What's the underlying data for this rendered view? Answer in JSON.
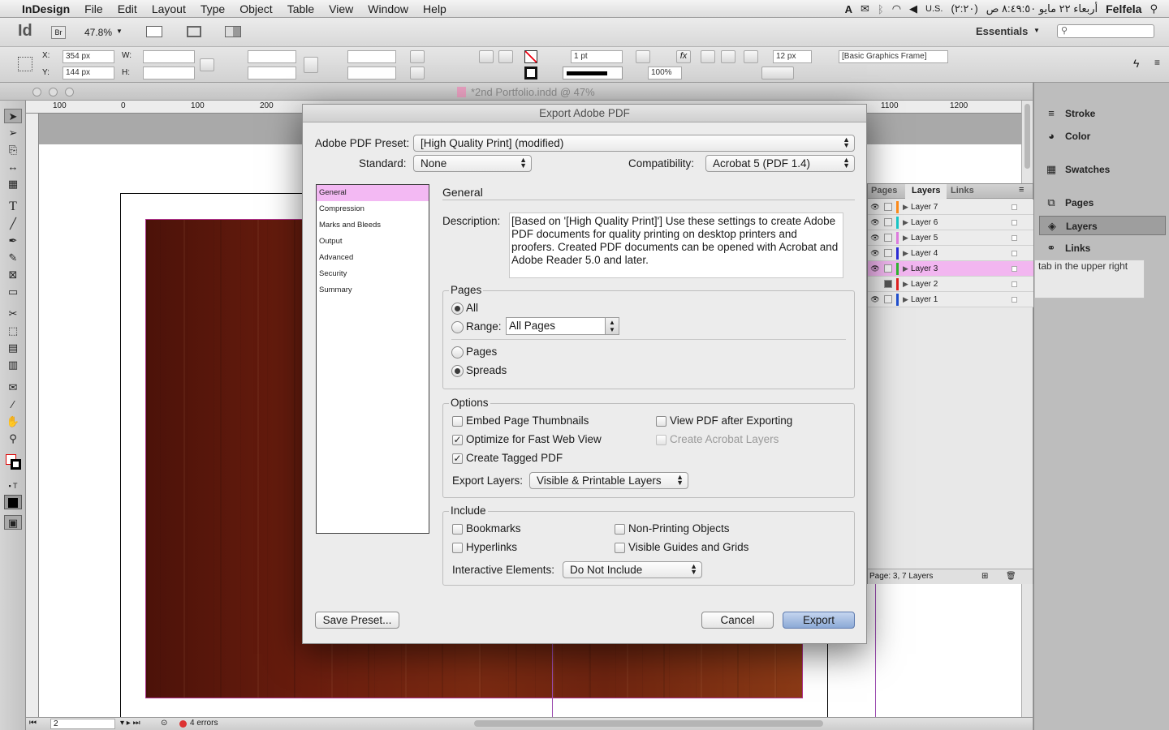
{
  "menubar": {
    "apple": "",
    "app": "InDesign",
    "items": [
      "File",
      "Edit",
      "Layout",
      "Type",
      "Object",
      "Table",
      "View",
      "Window",
      "Help"
    ],
    "status": {
      "input": "U.S.",
      "battery": "(٢:٢٠)",
      "clock": "أربعاء ٢٢ مايو  ٨:٤٩:٥٠ ص",
      "user": "Felfela"
    }
  },
  "appbar": {
    "logo": "Id",
    "bridge": "Br",
    "zoom": "47.8%",
    "workspace": "Essentials"
  },
  "control": {
    "x_label": "X:",
    "x": "354 px",
    "y_label": "Y:",
    "y": "144 px",
    "w_label": "W:",
    "h_label": "H:",
    "stroke_weight": "1 pt",
    "scale": "100%",
    "offset": "12 px",
    "style": "[Basic Graphics Frame]"
  },
  "document": {
    "tab_title": "*2nd Portfolio.indd @ 47%"
  },
  "ruler": {
    "h_ticks": [
      "100",
      "0",
      "100",
      "200",
      "1100",
      "1200"
    ]
  },
  "statusbar": {
    "page": "2",
    "errors": "4 errors"
  },
  "dock": {
    "items": [
      "Stroke",
      "Color",
      "Swatches",
      "Pages",
      "Layers",
      "Links"
    ]
  },
  "layers_panel": {
    "tabs": [
      "Pages",
      "Layers",
      "Links"
    ],
    "layers": [
      "Layer 7",
      "Layer 6",
      "Layer 5",
      "Layer 4",
      "Layer 3",
      "Layer 2",
      "Layer 1"
    ],
    "selected": "Layer 3",
    "footer": "Page: 3, 7 Layers",
    "swatch_colors": [
      "#ff8c1a",
      "#18c8c8",
      "#e17de1",
      "#2b2bd8",
      "#2fb52f",
      "#e02020",
      "#2050d0"
    ]
  },
  "hint_text": "tab in the upper right",
  "dialog": {
    "title": "Export Adobe PDF",
    "preset_label": "Adobe PDF Preset:",
    "preset": "[High Quality Print] (modified)",
    "standard_label": "Standard:",
    "standard": "None",
    "compat_label": "Compatibility:",
    "compat": "Acrobat 5 (PDF 1.4)",
    "categories": [
      "General",
      "Compression",
      "Marks and Bleeds",
      "Output",
      "Advanced",
      "Security",
      "Summary"
    ],
    "section": "General",
    "desc_label": "Description:",
    "description": "[Based on '[High Quality Print]'] Use these settings to create Adobe PDF documents for quality printing on desktop printers and proofers.  Created PDF documents can be opened with Acrobat and Adobe Reader 5.0 and later.",
    "pages": {
      "title": "Pages",
      "all": "All",
      "range": "Range:",
      "range_value": "All Pages",
      "pages": "Pages",
      "spreads": "Spreads"
    },
    "options": {
      "title": "Options",
      "embed": "Embed Page Thumbnails",
      "optimize": "Optimize for Fast Web View",
      "tagged": "Create Tagged PDF",
      "view_after": "View PDF after Exporting",
      "acrobat_layers": "Create Acrobat Layers",
      "export_layers_label": "Export Layers:",
      "export_layers": "Visible & Printable Layers"
    },
    "include": {
      "title": "Include",
      "bookmarks": "Bookmarks",
      "hyperlinks": "Hyperlinks",
      "nonprinting": "Non-Printing Objects",
      "guides": "Visible Guides and Grids",
      "interactive_label": "Interactive Elements:",
      "interactive": "Do Not Include"
    },
    "buttons": {
      "save_preset": "Save Preset...",
      "cancel": "Cancel",
      "export": "Export"
    }
  }
}
